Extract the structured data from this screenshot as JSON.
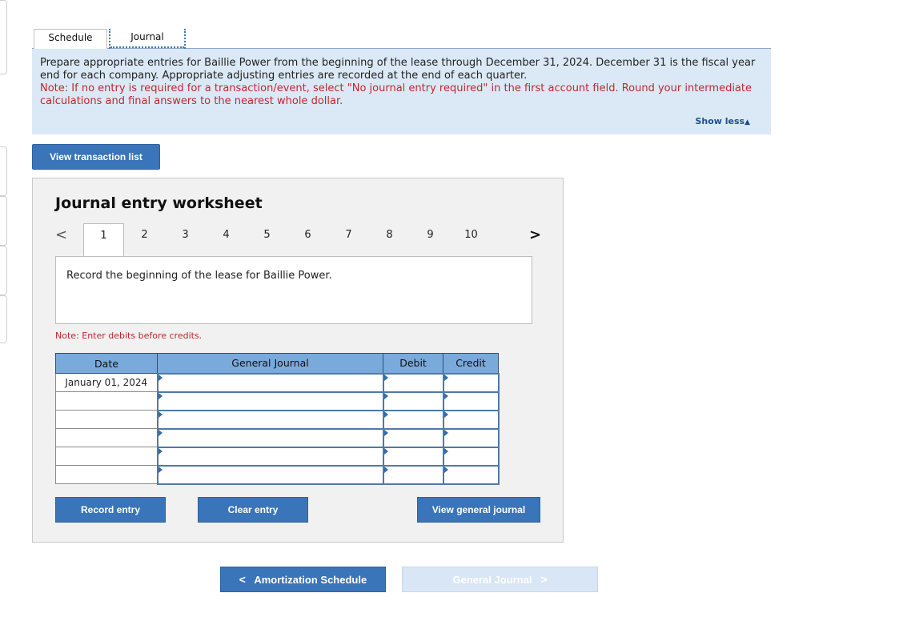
{
  "tabs": {
    "schedule": "Schedule",
    "journal": "Journal"
  },
  "info": {
    "instruction": "Prepare appropriate entries for Baillie Power from the beginning of the lease through December 31, 2024. December 31 is the fiscal year end for each company. Appropriate adjusting entries are recorded at the end of each quarter.",
    "note": "Note: If no entry is required for a transaction/event, select \"No journal entry required\" in the first account field. Round your intermediate calculations and final answers to the nearest whole dollar.",
    "show_less": "Show less",
    "show_less_icon": "▲"
  },
  "view_transaction_list": "View transaction list",
  "worksheet": {
    "title": "Journal entry worksheet",
    "prev_icon": "<",
    "next_icon": ">",
    "pages": [
      "1",
      "2",
      "3",
      "4",
      "5",
      "6",
      "7",
      "8",
      "9",
      "10"
    ],
    "active_page": "1",
    "description": "Record the beginning of the lease for Baillie Power.",
    "note": "Note: Enter debits before credits.",
    "columns": {
      "date": "Date",
      "account": "General Journal",
      "debit": "Debit",
      "credit": "Credit"
    },
    "rows": [
      {
        "date": "January 01, 2024",
        "account": "",
        "debit": "",
        "credit": ""
      },
      {
        "date": "",
        "account": "",
        "debit": "",
        "credit": ""
      },
      {
        "date": "",
        "account": "",
        "debit": "",
        "credit": ""
      },
      {
        "date": "",
        "account": "",
        "debit": "",
        "credit": ""
      },
      {
        "date": "",
        "account": "",
        "debit": "",
        "credit": ""
      },
      {
        "date": "",
        "account": "",
        "debit": "",
        "credit": ""
      }
    ],
    "record_entry": "Record entry",
    "clear_entry": "Clear entry",
    "view_general_journal": "View general journal"
  },
  "bottom_nav": {
    "prev_label": "Amortization Schedule",
    "prev_icon": "<",
    "next_label": "General Journal",
    "next_icon": ">"
  },
  "colors": {
    "accent": "#3a74b9",
    "info_bg": "#dbe9f6",
    "note_red": "#c0282e",
    "header_blue": "#7aa9dc"
  }
}
